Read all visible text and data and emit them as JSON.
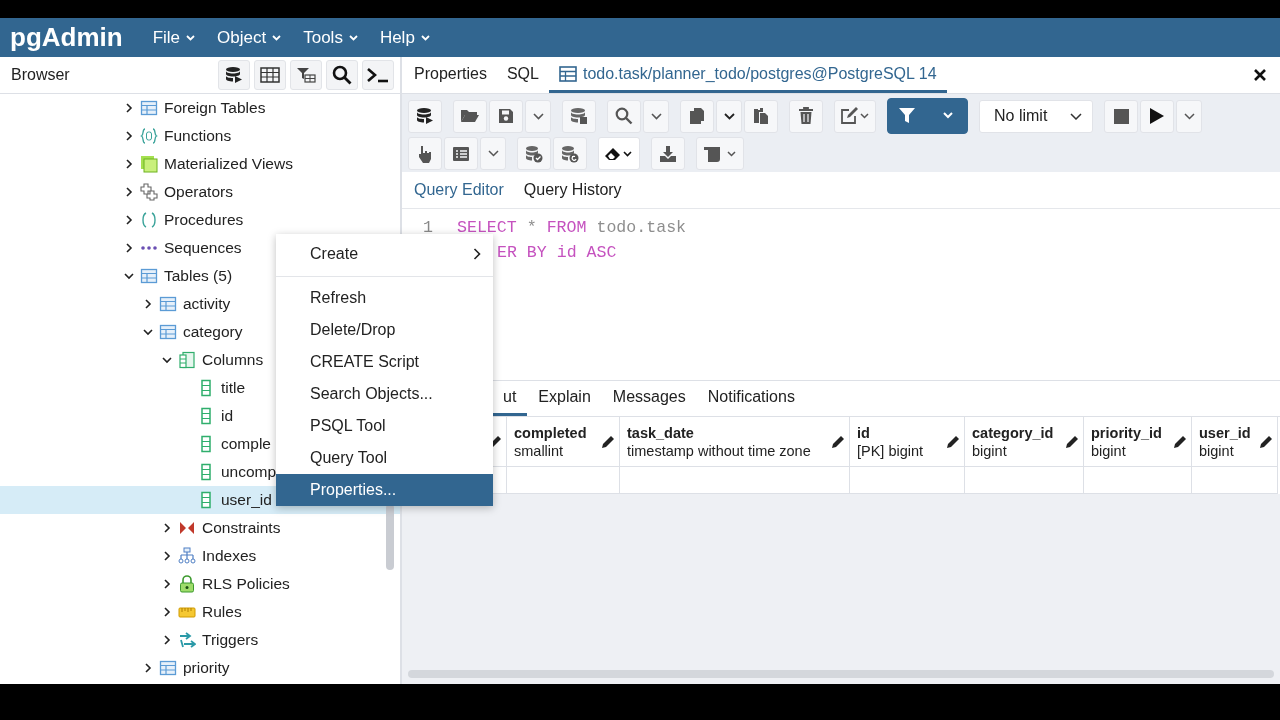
{
  "menubar": {
    "logo": "pgAdmin",
    "menus": [
      "File",
      "Object",
      "Tools",
      "Help"
    ]
  },
  "browser": {
    "title": "Browser",
    "tree": [
      {
        "label": "Foreign Tables",
        "kind": "foreign_table",
        "expanded": false,
        "selected": false
      },
      {
        "label": "Functions",
        "kind": "function",
        "expanded": false,
        "selected": false
      },
      {
        "label": "Materialized Views",
        "kind": "mview",
        "expanded": false,
        "selected": false
      },
      {
        "label": "Operators",
        "kind": "operator",
        "expanded": false,
        "selected": false
      },
      {
        "label": "Procedures",
        "kind": "procedure",
        "expanded": false,
        "selected": false
      },
      {
        "label": "Sequences",
        "kind": "sequence",
        "expanded": false,
        "selected": false
      },
      {
        "label": "Tables (5)",
        "kind": "tables",
        "expanded": true,
        "selected": false,
        "children": [
          {
            "label": "activity",
            "kind": "table",
            "expanded": false,
            "selected": false
          },
          {
            "label": "category",
            "kind": "table",
            "expanded": true,
            "selected": false,
            "children": [
              {
                "label": "Columns",
                "kind": "columns",
                "expanded": true,
                "selected": false,
                "children": [
                  {
                    "label": "title",
                    "kind": "column",
                    "selected": false
                  },
                  {
                    "label": "id",
                    "kind": "column",
                    "selected": false
                  },
                  {
                    "label": "comple",
                    "kind": "column",
                    "selected": false
                  },
                  {
                    "label": "uncomp",
                    "kind": "column",
                    "selected": false
                  },
                  {
                    "label": "user_id",
                    "kind": "column",
                    "selected": true
                  }
                ]
              },
              {
                "label": "Constraints",
                "kind": "constraint",
                "expanded": false,
                "selected": false
              },
              {
                "label": "Indexes",
                "kind": "index",
                "expanded": false,
                "selected": false
              },
              {
                "label": "RLS Policies",
                "kind": "policy",
                "expanded": false,
                "selected": false
              },
              {
                "label": "Rules",
                "kind": "rule",
                "expanded": false,
                "selected": false
              },
              {
                "label": "Triggers",
                "kind": "trigger",
                "expanded": false,
                "selected": false
              }
            ]
          },
          {
            "label": "priority",
            "kind": "table",
            "expanded": false,
            "selected": false
          }
        ]
      }
    ]
  },
  "tabs": [
    {
      "label": "Properties",
      "selected": false
    },
    {
      "label": "SQL",
      "selected": false
    },
    {
      "label": "todo.task/planner_todo/postgres@PostgreSQL 14",
      "selected": true,
      "kind": "query"
    }
  ],
  "toolbar": {
    "row_limit": "No limit"
  },
  "editor_tabs": [
    {
      "label": "Query Editor",
      "selected": true
    },
    {
      "label": "Query History",
      "selected": false
    }
  ],
  "editor": {
    "lines": [
      {
        "number": "1",
        "tokens": [
          {
            "text": "SELECT",
            "kind": "keyword"
          },
          {
            "text": " * ",
            "kind": "plain"
          },
          {
            "text": "FROM",
            "kind": "keyword"
          },
          {
            "text": " todo.task",
            "kind": "plain"
          }
        ]
      },
      {
        "tokens": [
          {
            "text": "ER BY id ASC",
            "kind": "keyword"
          }
        ]
      }
    ]
  },
  "results_tabs": [
    {
      "label": "ut",
      "selected": true
    },
    {
      "label": "Explain",
      "selected": false
    },
    {
      "label": "Messages",
      "selected": false
    },
    {
      "label": "Notifications",
      "selected": false
    }
  ],
  "grid": {
    "columns": [
      {
        "name": "completed",
        "type": "smallint"
      },
      {
        "name": "task_date",
        "type": "timestamp without time zone"
      },
      {
        "name": "id",
        "type": "[PK] bigint"
      },
      {
        "name": "category_id",
        "type": "bigint"
      },
      {
        "name": "priority_id",
        "type": "bigint"
      },
      {
        "name": "user_id",
        "type": "bigint"
      }
    ]
  },
  "context_menu": {
    "groups": [
      [
        {
          "label": "Create",
          "kind": "submenu",
          "selected": false
        }
      ],
      [
        {
          "label": "Refresh",
          "kind": "item",
          "selected": false
        },
        {
          "label": "Delete/Drop",
          "kind": "item",
          "selected": false
        },
        {
          "label": "CREATE Script",
          "kind": "item",
          "selected": false
        },
        {
          "label": "Search Objects...",
          "kind": "item",
          "selected": false
        },
        {
          "label": "PSQL Tool",
          "kind": "item",
          "selected": false
        },
        {
          "label": "Query Tool",
          "kind": "item",
          "selected": false
        },
        {
          "label": "Properties...",
          "kind": "item",
          "selected": true
        }
      ]
    ]
  }
}
